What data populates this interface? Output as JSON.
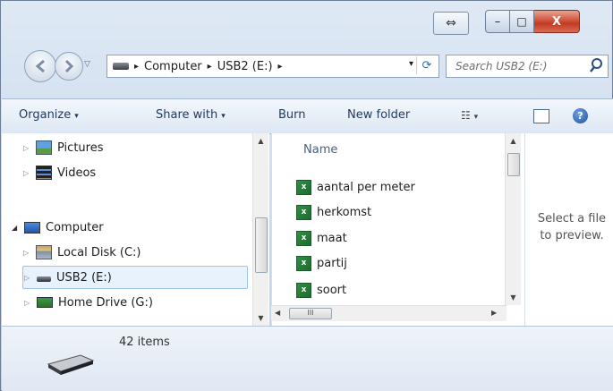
{
  "window": {
    "accent": "#c9d9ec",
    "close_color": "#c23a23"
  },
  "title_bar": {
    "minimize_glyph": "–",
    "maximize_glyph": "□",
    "close_glyph": "X",
    "resize_glyph": "⇔"
  },
  "address_bar": {
    "crumbs": [
      "Computer",
      "USB2 (E:)"
    ],
    "separator": "▸",
    "dropdown_glyph": "▾",
    "refresh_glyph": "⟳"
  },
  "search": {
    "placeholder": "Search USB2 (E:)",
    "icon": "search-icon"
  },
  "toolbar": {
    "organize": "Organize",
    "share_with": "Share with",
    "burn": "Burn",
    "new_folder": "New folder",
    "views_glyph": "☷",
    "help_glyph": "?",
    "arrow": "▾"
  },
  "nav_pane": {
    "items": [
      {
        "label": "Pictures",
        "icon": "pictures-icon"
      },
      {
        "label": "Videos",
        "icon": "videos-icon"
      },
      {
        "label": "Computer",
        "icon": "computer-icon"
      },
      {
        "label": "Local Disk (C:)",
        "icon": "local-disk-icon"
      },
      {
        "label": "USB2 (E:)",
        "icon": "usb-drive-icon",
        "selected": true
      },
      {
        "label": "Home Drive (G:)",
        "icon": "network-drive-icon"
      }
    ]
  },
  "file_list": {
    "column": "Name",
    "files": [
      "aantal per meter",
      "herkomst",
      "maat",
      "partij",
      "soort"
    ]
  },
  "preview": {
    "line1": "Select a file",
    "line2": "to preview."
  },
  "details": {
    "count": "42 items"
  }
}
